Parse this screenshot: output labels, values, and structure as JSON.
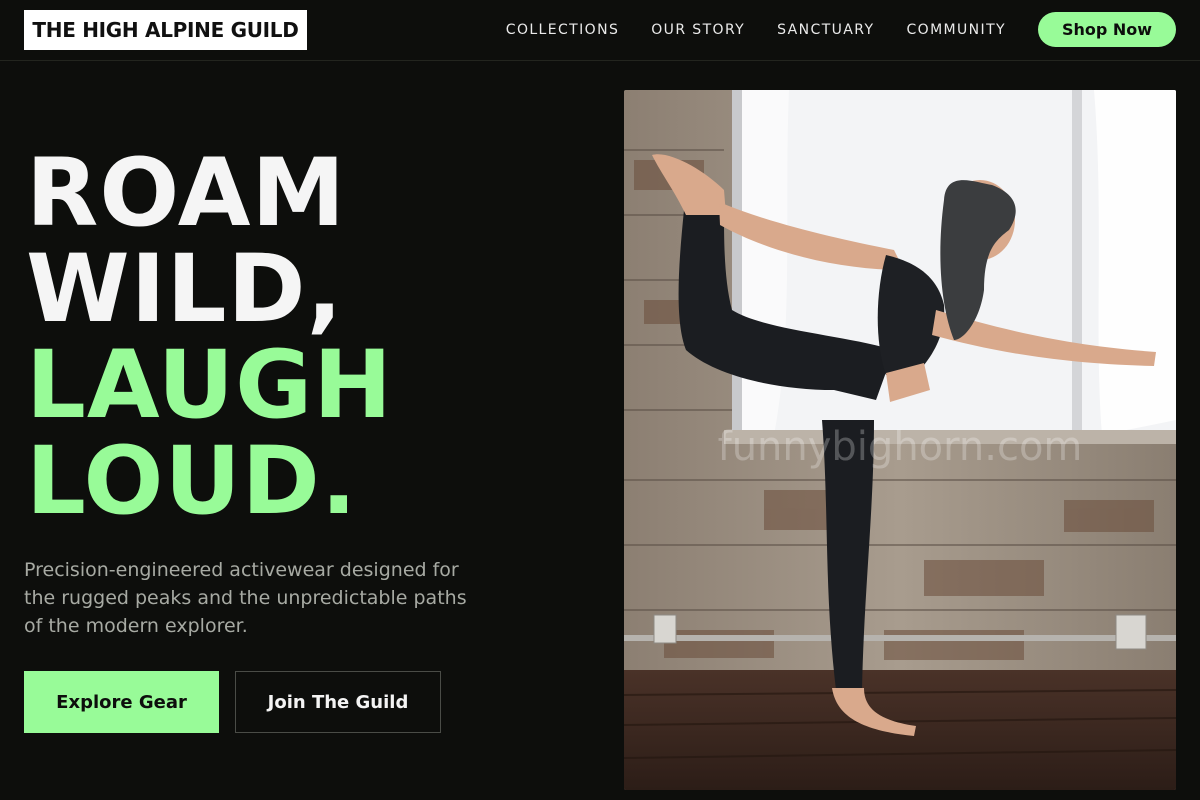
{
  "nav": {
    "logo": "THE HIGH ALPINE GUILD",
    "links": [
      "COLLECTIONS",
      "OUR STORY",
      "SANCTUARY",
      "COMMUNITY"
    ],
    "cta": "Shop Now"
  },
  "hero": {
    "headline": {
      "line1": "ROAM",
      "line2": "WILD,",
      "line3": "LAUGH",
      "line4": "LOUD."
    },
    "subcopy": "Precision-engineered activewear designed for the rugged peaks and the unpredictable paths of the modern explorer.",
    "primary_cta": "Explore Gear",
    "secondary_cta": "Join The Guild",
    "image_watermark": "funnybighorn.com"
  },
  "colors": {
    "background": "#0d0e0c",
    "accent": "#98fb98",
    "text": "#f4f4f4",
    "muted": "#a7aaa3"
  }
}
